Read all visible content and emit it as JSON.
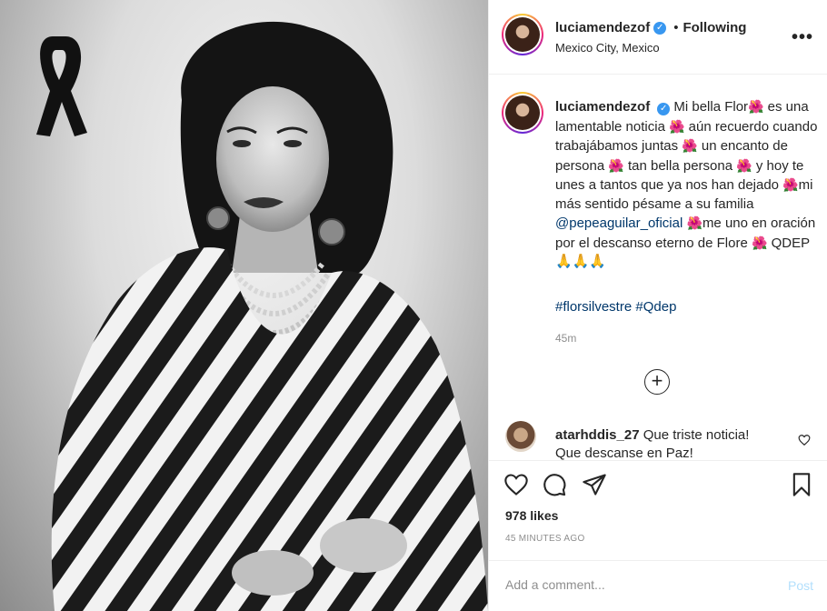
{
  "post": {
    "author": "luciamendezof",
    "verified_icon": "verified-badge-icon",
    "follow_separator": "•",
    "follow_status": "Following",
    "location": "Mexico City, Mexico",
    "more_icon": "more-options-icon",
    "more_label": "•••"
  },
  "caption": {
    "segments": [
      "Mi bella Flor",
      " es una lamentable noticia ",
      " aún recuerdo cuando trabajábamos juntas ",
      " un encanto de persona ",
      " tan bella persona ",
      " y hoy te unes a tantos que ya nos han dejado ",
      "mi más sentido pésame a su familia ",
      "me uno en oración por el descanso eterno de Flore ",
      " QDEP 🙏🙏🙏"
    ],
    "flower": "🌺",
    "mention": "@pepeaguilar_oficial",
    "hashtags": [
      "#florsilvestre",
      "#Qdep"
    ],
    "time": "45m"
  },
  "load_more_label": "+",
  "comment": {
    "user": "atarhddis_27",
    "text": "Que triste noticia! Que descanse en Paz!"
  },
  "actions": {
    "likes": "978 likes",
    "posted": "45 MINUTES AGO"
  },
  "add_comment": {
    "placeholder": "Add a comment...",
    "post_label": "Post"
  },
  "colors": {
    "link": "#00376b",
    "muted": "#8e8e8e",
    "verified": "#3897f0",
    "post_disabled": "#b2dffc"
  }
}
